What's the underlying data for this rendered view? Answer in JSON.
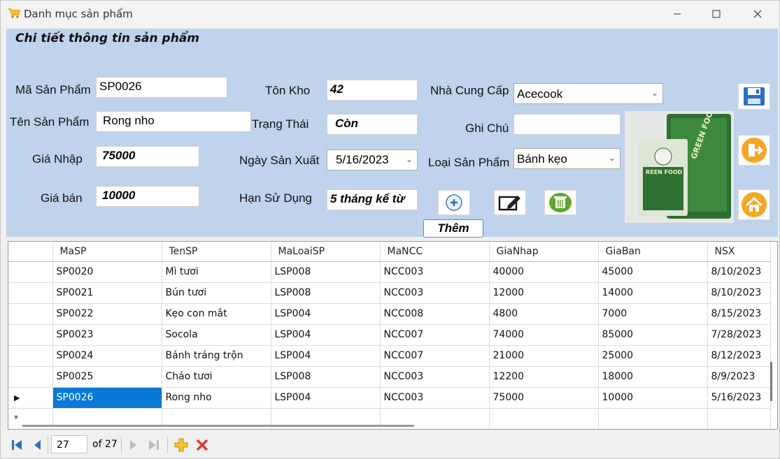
{
  "window": {
    "title": "Danh mục sản phẩm"
  },
  "panel": {
    "heading": "Chi tiết thông tin sản phẩm",
    "fields": {
      "ma_sp": {
        "label": "Mã Sản Phẩm",
        "value": "SP0026"
      },
      "ten_sp": {
        "label": "Tên Sản Phẩm",
        "value": "Rong nho"
      },
      "gia_nhap": {
        "label": "Giá Nhập",
        "value": "75000"
      },
      "gia_ban": {
        "label": "Giá bán",
        "value": "10000"
      },
      "ton_kho": {
        "label": "Tôn Kho",
        "value": "42"
      },
      "trang_thai": {
        "label": "Trạng Thái",
        "value": "Còn"
      },
      "ngay_san_xuat": {
        "label": "Ngày Sản Xuất",
        "value": "5/16/2023"
      },
      "han_su_dung": {
        "label": "Hạn Sử Dụng",
        "value": "5 tháng kể từ"
      },
      "nha_cung_cap": {
        "label": "Nhà Cung Cấp",
        "value": "Acecook"
      },
      "ghi_chu": {
        "label": "Ghi Chú",
        "value": ""
      },
      "loai_san_pham": {
        "label": "Loại Sản Phẩm",
        "value": "Bánh kẹo"
      }
    },
    "add_label": "Thêm",
    "photo_text": [
      "GREEN FOOD",
      "REEN FOOD"
    ]
  },
  "grid": {
    "columns": [
      "MaSP",
      "TenSP",
      "MaLoaiSP",
      "MaNCC",
      "GiaNhap",
      "GiaBan",
      "NSX"
    ],
    "rows": [
      [
        "SP0020",
        "Mì tươi",
        "LSP008",
        "NCC003",
        "40000",
        "45000",
        "8/10/2023"
      ],
      [
        "SP0021",
        "Bún tươi",
        "LSP008",
        "NCC003",
        "12000",
        "14000",
        "8/10/2023"
      ],
      [
        "SP0022",
        "Kẹo con mắt",
        "LSP004",
        "NCC008",
        "4800",
        "7000",
        "8/15/2023"
      ],
      [
        "SP0023",
        "Socola",
        "LSP004",
        "NCC007",
        "74000",
        "85000",
        "7/28/2023"
      ],
      [
        "SP0024",
        "Bánh tráng trộn",
        "LSP004",
        "NCC007",
        "21000",
        "25000",
        "8/12/2023"
      ],
      [
        "SP0025",
        "Cháo tươi",
        "LSP008",
        "NCC003",
        "12200",
        "18000",
        "8/9/2023"
      ],
      [
        "SP0026",
        "Rong nho",
        "LSP004",
        "NCC003",
        "75000",
        "10000",
        "5/16/2023"
      ]
    ]
  },
  "navigator": {
    "position": "27",
    "count_text": "of 27"
  },
  "colors": {
    "panel_bg": "#bfd3ec",
    "selection": "#0a78d7"
  }
}
